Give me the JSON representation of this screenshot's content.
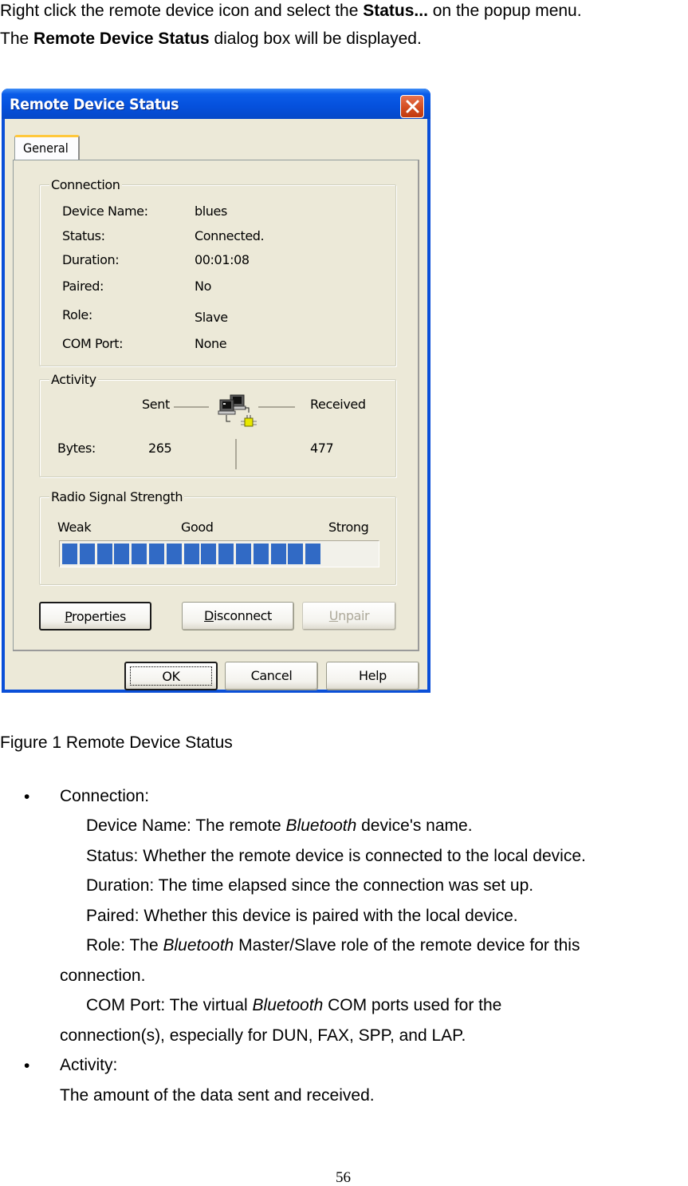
{
  "intro": {
    "line1_pre": "Right click the remote device icon and select the ",
    "line1_bold": "Status...",
    "line1_post": " on the popup menu.",
    "line2_pre": "The ",
    "line2_bold": "Remote Device Status",
    "line2_post": " dialog box will be displayed."
  },
  "dialog": {
    "title": "Remote Device Status",
    "tab": "General",
    "connection": {
      "title": "Connection",
      "rows": [
        {
          "label": "Device Name:",
          "value": "blues"
        },
        {
          "label": "Status:",
          "value": "Connected."
        },
        {
          "label": "Duration:",
          "value": "00:01:08"
        },
        {
          "label": "Paired:",
          "value": "No"
        },
        {
          "label": "Role:",
          "value": "Slave"
        },
        {
          "label": "COM Port:",
          "value": "None"
        }
      ]
    },
    "activity": {
      "title": "Activity",
      "sent_label": "Sent",
      "received_label": "Received",
      "bytes_label": "Bytes:",
      "sent_bytes": "265",
      "received_bytes": "477"
    },
    "signal": {
      "title": "Radio Signal Strength",
      "weak": "Weak",
      "good": "Good",
      "strong": "Strong",
      "filled_blocks": 15,
      "level_percent": 82,
      "bar_color": "#316ac5"
    },
    "buttons": {
      "properties_u": "P",
      "properties_rest": "roperties",
      "disconnect_u": "D",
      "disconnect_rest": "isconnect",
      "unpair_u": "U",
      "unpair_rest": "npair",
      "ok": "OK",
      "cancel": "Cancel",
      "help": "Help"
    }
  },
  "caption": "Figure 1 Remote Device Status",
  "bullets": {
    "connection_head": "Connection:",
    "device_name_pre": "Device Name: The remote ",
    "device_name_it": "Bluetooth",
    "device_name_post": " device's name.",
    "status": "Status: Whether the remote device is connected to the local device.",
    "duration": "Duration: The time elapsed since the connection was set up.",
    "paired": "Paired: Whether this device is paired with the local device.",
    "role_pre": "Role: The ",
    "role_it": "Bluetooth",
    "role_post": " Master/Slave role of the remote device for this",
    "role_cont": "connection.",
    "com_pre": "COM Port: The virtual ",
    "com_it": "Bluetooth",
    "com_post": " COM ports used for the",
    "com_cont": "connection(s), especially for DUN, FAX, SPP, and LAP.",
    "activity_head": "Activity:",
    "activity_desc": "The amount of the data sent and received."
  },
  "page_number": "56"
}
